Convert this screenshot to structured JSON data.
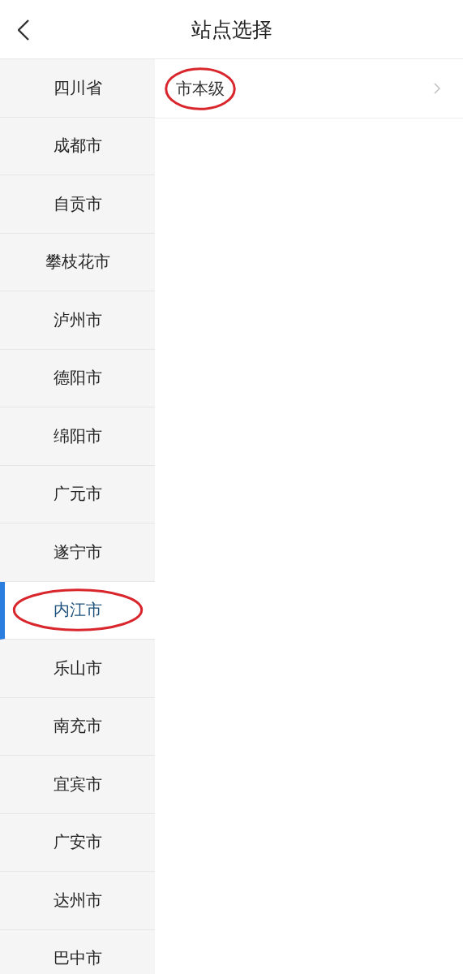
{
  "header": {
    "title": "站点选择"
  },
  "sidebar": {
    "items": [
      {
        "label": "四川省",
        "selected": false,
        "circled": false
      },
      {
        "label": "成都市",
        "selected": false,
        "circled": false
      },
      {
        "label": "自贡市",
        "selected": false,
        "circled": false
      },
      {
        "label": "攀枝花市",
        "selected": false,
        "circled": false
      },
      {
        "label": "泸州市",
        "selected": false,
        "circled": false
      },
      {
        "label": "德阳市",
        "selected": false,
        "circled": false
      },
      {
        "label": "绵阳市",
        "selected": false,
        "circled": false
      },
      {
        "label": "广元市",
        "selected": false,
        "circled": false
      },
      {
        "label": "遂宁市",
        "selected": false,
        "circled": false
      },
      {
        "label": "内江市",
        "selected": true,
        "circled": true
      },
      {
        "label": "乐山市",
        "selected": false,
        "circled": false
      },
      {
        "label": "南充市",
        "selected": false,
        "circled": false
      },
      {
        "label": "宜宾市",
        "selected": false,
        "circled": false
      },
      {
        "label": "广安市",
        "selected": false,
        "circled": false
      },
      {
        "label": "达州市",
        "selected": false,
        "circled": false
      },
      {
        "label": "巴中市",
        "selected": false,
        "circled": false
      }
    ]
  },
  "list": {
    "items": [
      {
        "label": "市本级",
        "circled": true
      }
    ]
  }
}
